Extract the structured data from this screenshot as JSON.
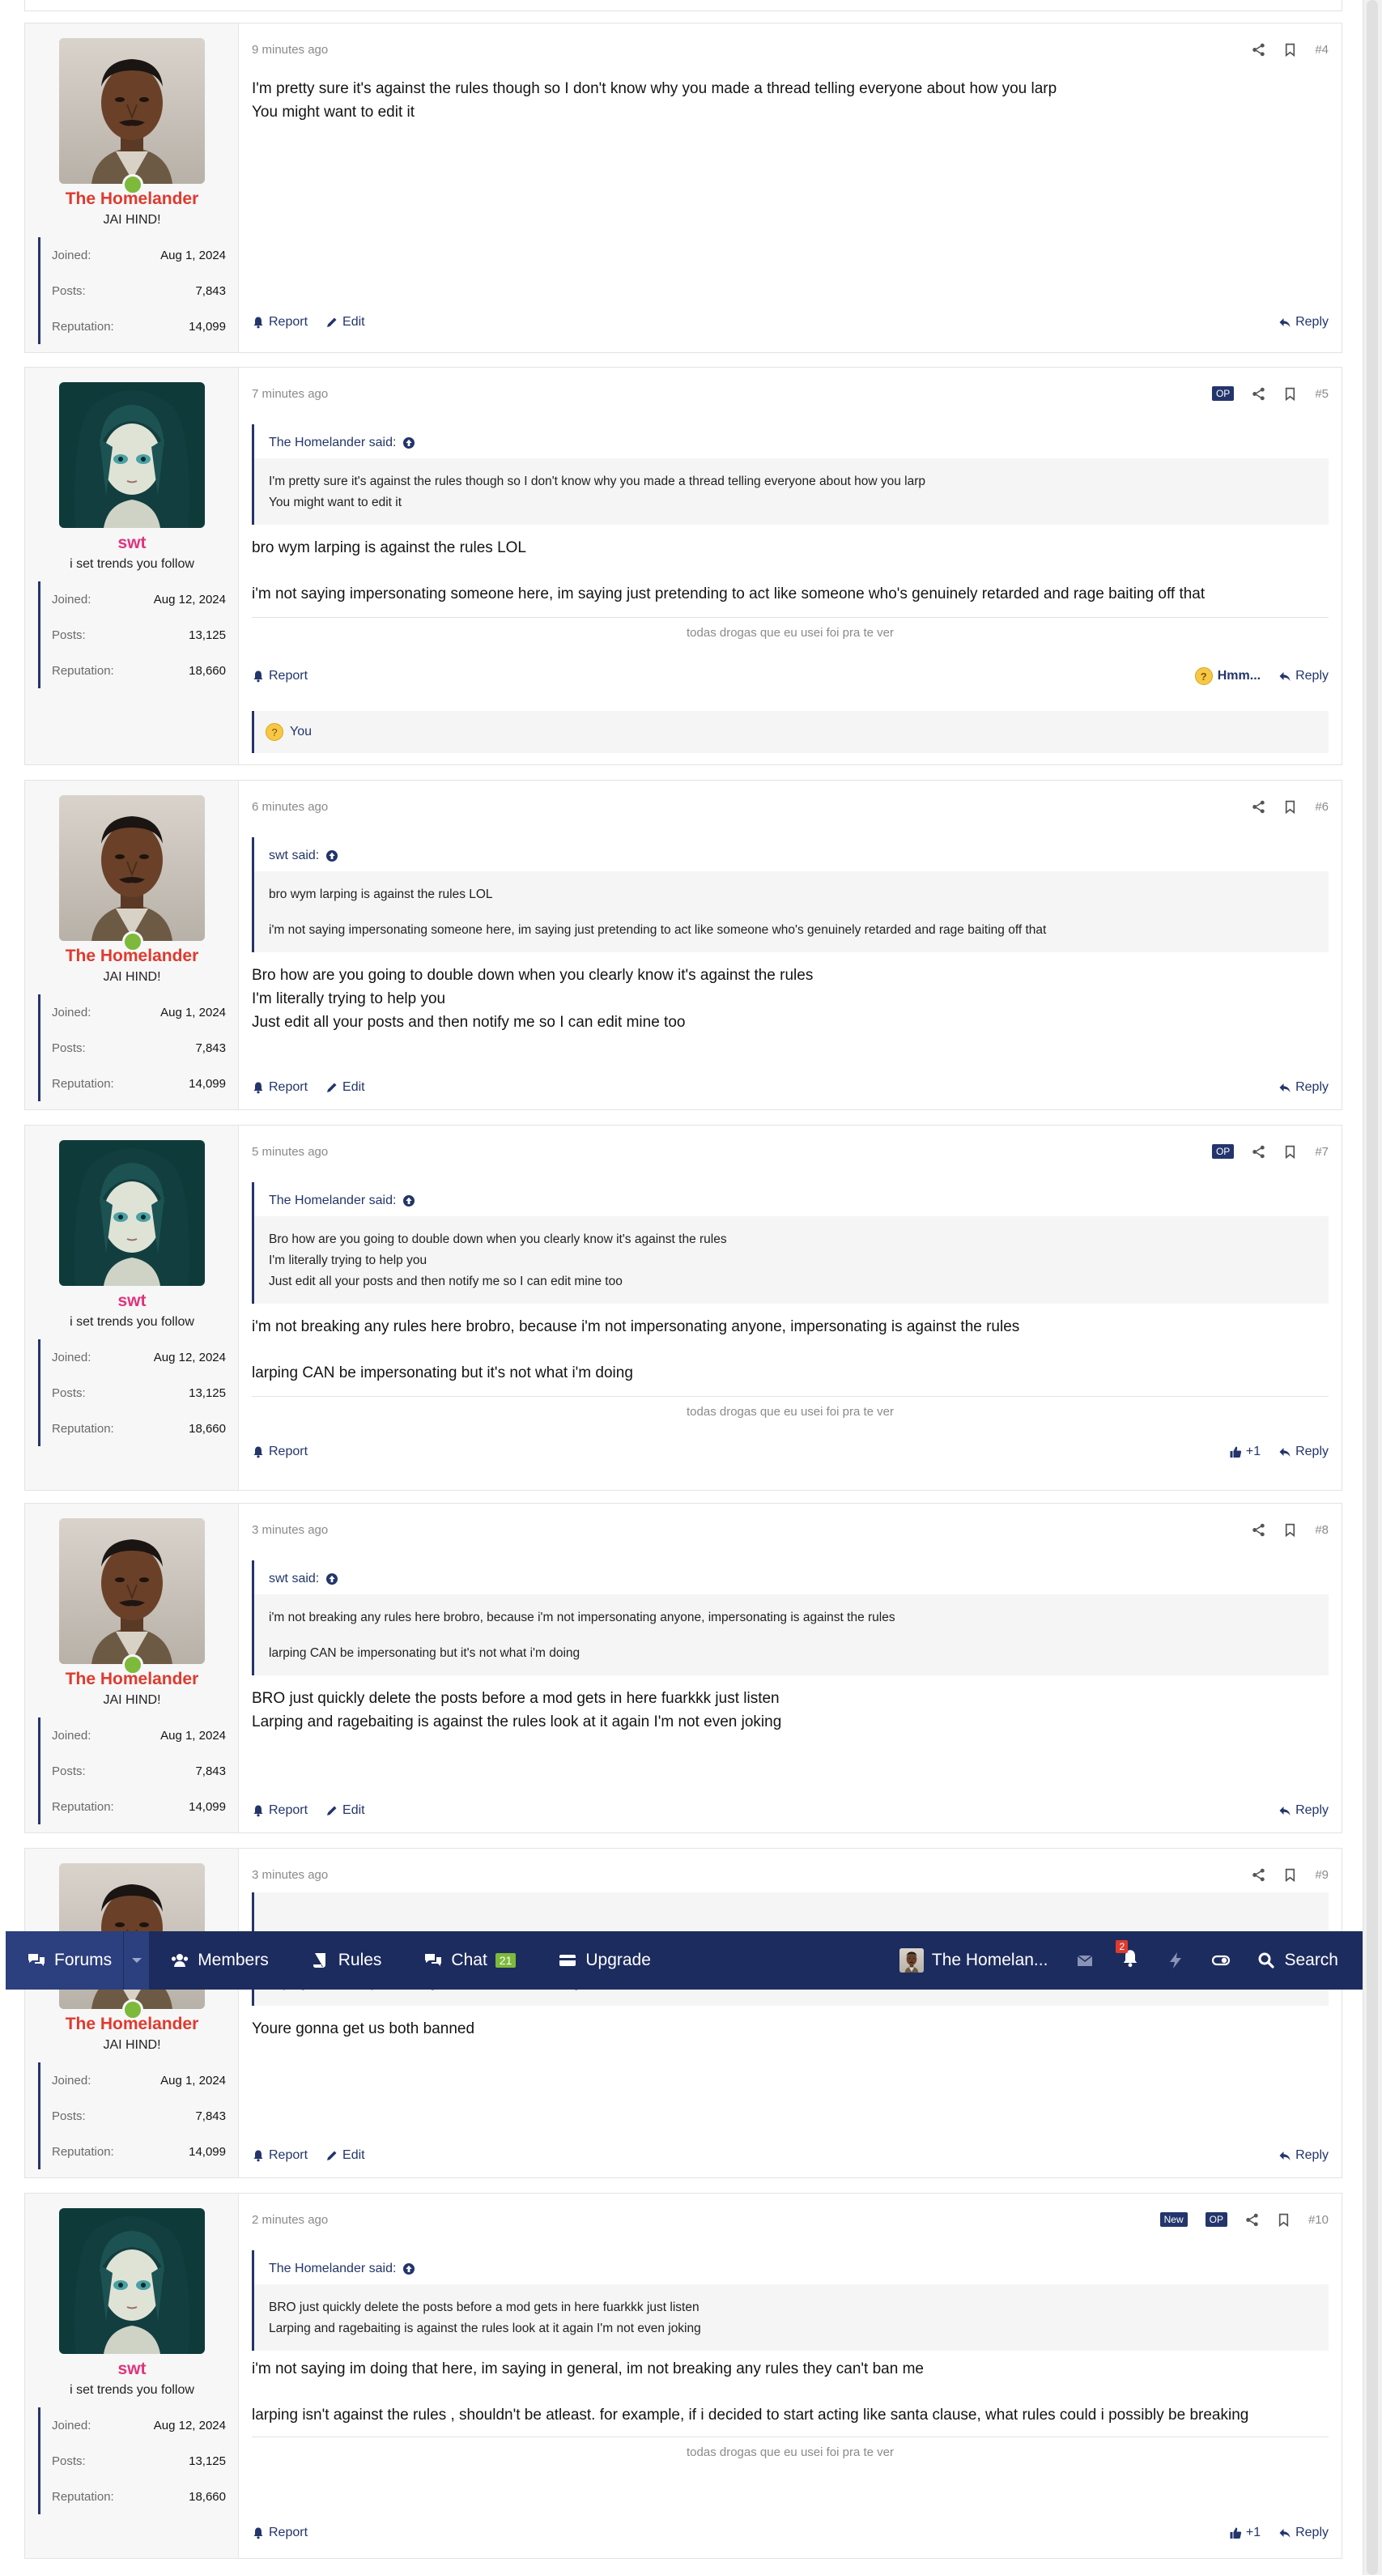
{
  "nav": {
    "forums": "Forums",
    "members": "Members",
    "rules": "Rules",
    "chat": "Chat",
    "chat_count": "21",
    "upgrade": "Upgrade",
    "account": "The Homelan...",
    "alerts_count": "2",
    "search": "Search"
  },
  "common": {
    "joined_label": "Joined:",
    "posts_label": "Posts:",
    "reputation_label": "Reputation:",
    "report": "Report",
    "edit": "Edit",
    "reply": "Reply",
    "op_badge": "OP",
    "new_badge": "New",
    "plus_one": "+1",
    "hmm": "Hmm...",
    "you": "You",
    "signature": "todas drogas que eu usei foi pra te ver"
  },
  "users": {
    "homelander": {
      "name": "The Homelander",
      "title": "JAI HIND!",
      "joined": "Aug 1, 2024",
      "posts": "7,843",
      "reputation": "14,099"
    },
    "swt": {
      "name": "swt",
      "title": "i set trends you follow",
      "joined": "Aug 12, 2024",
      "posts": "13,125",
      "reputation": "18,660"
    }
  },
  "posts": [
    {
      "number": "#4",
      "time": "9 minutes ago",
      "lines": [
        "I'm pretty sure it's against the rules though so I don't know why you made a thread telling everyone about how you larp",
        "You might want to edit it"
      ]
    },
    {
      "number": "#5",
      "time": "7 minutes ago",
      "quote_author": "The Homelander said:",
      "quote_lines": [
        "I'm pretty sure it's against the rules though so I don't know why you made a thread telling everyone about how you larp",
        "You might want to edit it"
      ],
      "lines": [
        "bro wym larping is against the rules LOL",
        "i'm not saying impersonating someone here, im saying just pretending to act like someone who's genuinely retarded and rage baiting off that"
      ]
    },
    {
      "number": "#6",
      "time": "6 minutes ago",
      "quote_author": "swt said:",
      "quote_lines": [
        "bro wym larping is against the rules LOL",
        "i'm not saying impersonating someone here, im saying just pretending to act like someone who's genuinely retarded and rage baiting off that"
      ],
      "lines": [
        "Bro how are you going to double down when you clearly know it's against the rules",
        "I'm literally trying to help you",
        "Just edit all your posts and then notify me so I can edit mine too"
      ]
    },
    {
      "number": "#7",
      "time": "5 minutes ago",
      "quote_author": "The Homelander said:",
      "quote_lines": [
        "Bro how are you going to double down when you clearly know it's against the rules",
        "I'm literally trying to help you",
        "Just edit all your posts and then notify me so I can edit mine too"
      ],
      "lines": [
        "i'm not breaking any rules here brobro, because i'm not impersonating anyone, impersonating is against the rules",
        "larping CAN be impersonating but it's not what i'm doing"
      ]
    },
    {
      "number": "#8",
      "time": "3 minutes ago",
      "quote_author": "swt said:",
      "quote_lines": [
        "i'm not breaking any rules here brobro, because i'm not impersonating anyone, impersonating is against the rules",
        "larping CAN be impersonating but it's not what i'm doing"
      ],
      "lines": [
        "BRO just quickly delete the posts before a mod gets in here fuarkkk just listen",
        "Larping and ragebaiting is against the rules look at it again I'm not even joking"
      ]
    },
    {
      "number": "#9",
      "time": "3 minutes ago",
      "quote_visible": "larping CAN be impersonating but it's not what i'm doing",
      "lines": [
        "Youre gonna get us both banned"
      ]
    },
    {
      "number": "#10",
      "time": "2 minutes ago",
      "quote_author": "The Homelander said:",
      "quote_lines": [
        "BRO just quickly delete the posts before a mod gets in here fuarkkk just listen",
        "Larping and ragebaiting is against the rules look at it again I'm not even joking"
      ],
      "lines": [
        "i'm not saying im doing that here, im saying in general, im not breaking any rules they can't ban me",
        "larping isn't against the rules , shouldn't be atleast. for example, if i decided to start acting like santa clause, what rules could i possibly be breaking"
      ]
    }
  ]
}
